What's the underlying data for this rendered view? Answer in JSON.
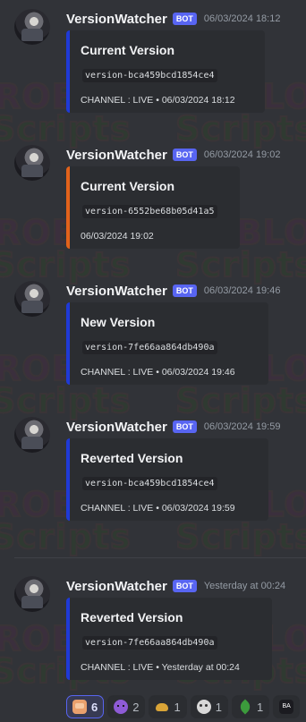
{
  "messages": [
    {
      "username": "VersionWatcher",
      "bot_tag": "BOT",
      "timestamp": "06/03/2024 18:12",
      "embed": {
        "color": "#1f3ad6",
        "title": "Current Version",
        "code": "version-bca459bcd1854ce4",
        "footer": "CHANNEL : LIVE • 06/03/2024 18:12"
      }
    },
    {
      "username": "VersionWatcher",
      "bot_tag": "BOT",
      "timestamp": "06/03/2024 19:02",
      "embed": {
        "color": "#e2621b",
        "title": "Current Version",
        "code": "version-6552be68b05d41a5",
        "footer": "06/03/2024 19:02"
      }
    },
    {
      "username": "VersionWatcher",
      "bot_tag": "BOT",
      "timestamp": "06/03/2024 19:46",
      "embed": {
        "color": "#1f3ad6",
        "title": "New Version",
        "code": "version-7fe66aa864db490a",
        "footer": "CHANNEL : LIVE • 06/03/2024 19:46"
      }
    },
    {
      "username": "VersionWatcher",
      "bot_tag": "BOT",
      "timestamp": "06/03/2024 19:59",
      "embed": {
        "color": "#1f3ad6",
        "title": "Reverted Version",
        "code": "version-bca459bcd1854ce4",
        "footer": "CHANNEL : LIVE • 06/03/2024 19:59"
      }
    },
    {
      "username": "VersionWatcher",
      "bot_tag": "BOT",
      "timestamp": "Yesterday at 00:24",
      "embed": {
        "color": "#1f3ad6",
        "title": "Reverted Version",
        "code": "version-7fe66aa864db490a",
        "footer": "CHANNEL : LIVE • Yesterday at 00:24"
      }
    }
  ],
  "reactions": [
    {
      "emoji": "cat-face-emoji",
      "count": "6",
      "active": true
    },
    {
      "emoji": "smiling-devil-emoji",
      "count": "2",
      "active": false
    },
    {
      "emoji": "dog-emoji",
      "count": "1",
      "active": false
    },
    {
      "emoji": "troll-face-emoji",
      "count": "1",
      "active": false
    },
    {
      "emoji": "leaf-emoji",
      "count": "1",
      "active": false
    },
    {
      "emoji": "text-emoji",
      "label": "BA",
      "active": false
    }
  ],
  "watermark": {
    "line1": "ROBLOX",
    "line2": "Scripts",
    "suffix": ".com"
  }
}
